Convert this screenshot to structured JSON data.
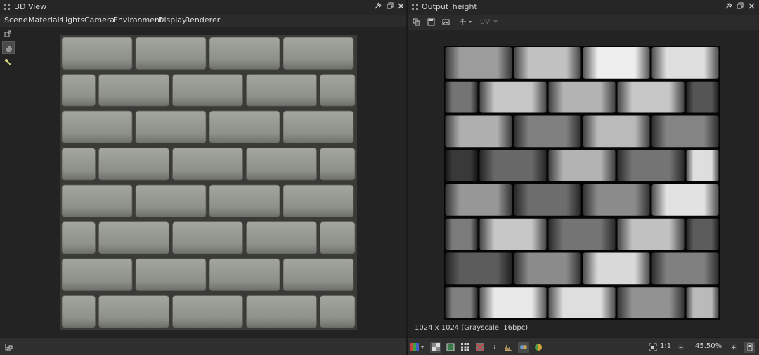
{
  "left_panel": {
    "title": "3D View",
    "menu": [
      "Scene",
      "Materials",
      "Lights",
      "Camera",
      "Environment",
      "Display",
      "Renderer"
    ]
  },
  "right_panel": {
    "title": "Output_height",
    "uv_label": "UV",
    "info": "1024 x 1024 (Grayscale, 16bpc)",
    "ratio_label": "1:1",
    "zoom": "45.50%"
  },
  "icons": {
    "pin": "pin-icon",
    "restore": "restore-icon",
    "close": "close-icon"
  },
  "colors": {
    "brick_3d": "#8e918a",
    "mortar_3d": "#3a3a36",
    "accent_active": "#5a7fb0"
  },
  "height_rows": [
    {
      "offset": 0,
      "tones": [
        0.62,
        0.78,
        0.97,
        0.9
      ]
    },
    {
      "offset": 1,
      "tones": [
        0.45,
        0.8,
        0.72,
        0.8,
        0.32
      ]
    },
    {
      "offset": 0,
      "tones": [
        0.7,
        0.5,
        0.75,
        0.52
      ]
    },
    {
      "offset": 1,
      "tones": [
        0.2,
        0.4,
        0.72,
        0.45,
        0.9
      ]
    },
    {
      "offset": 0,
      "tones": [
        0.6,
        0.42,
        0.55,
        0.92
      ]
    },
    {
      "offset": 1,
      "tones": [
        0.48,
        0.8,
        0.45,
        0.78,
        0.35
      ]
    },
    {
      "offset": 0,
      "tones": [
        0.35,
        0.55,
        0.88,
        0.5
      ]
    },
    {
      "offset": 1,
      "tones": [
        0.5,
        0.95,
        0.9,
        0.58,
        0.75
      ]
    }
  ]
}
